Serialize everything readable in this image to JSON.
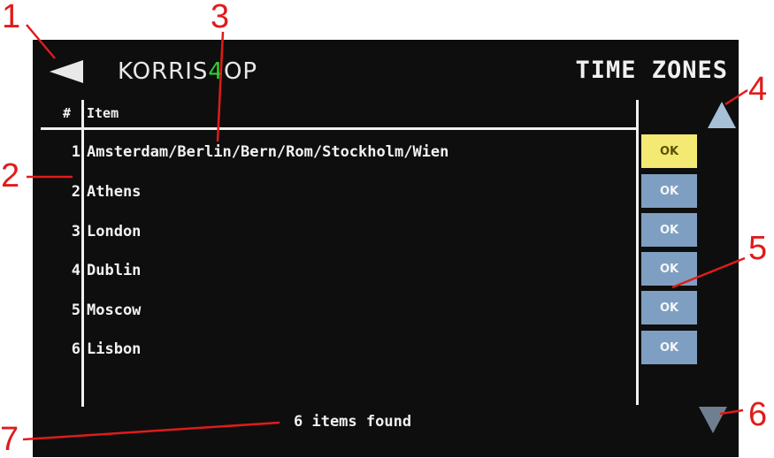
{
  "header": {
    "logo_text_1": "KORRIS",
    "logo_text_accent": "4",
    "logo_text_2": "OP",
    "title": "TIME ZONES"
  },
  "table": {
    "columns": [
      "#",
      "Item"
    ],
    "rows": [
      {
        "num": "1",
        "name": "Amsterdam/Berlin/Bern/Rom/Stockholm/Wien",
        "button": "OK",
        "selected": true
      },
      {
        "num": "2",
        "name": "Athens",
        "button": "OK",
        "selected": false
      },
      {
        "num": "3",
        "name": "London",
        "button": "OK",
        "selected": false
      },
      {
        "num": "4",
        "name": "Dublin",
        "button": "OK",
        "selected": false
      },
      {
        "num": "5",
        "name": "Moscow",
        "button": "OK",
        "selected": false
      },
      {
        "num": "6",
        "name": "Lisbon",
        "button": "OK",
        "selected": false
      }
    ]
  },
  "status_text": "6 items found",
  "callouts": [
    "1",
    "2",
    "3",
    "4",
    "5",
    "6",
    "7"
  ],
  "icons": {
    "back": "back-arrow-icon",
    "scroll_up": "scroll-up-arrow-icon",
    "scroll_down": "scroll-down-arrow-icon"
  },
  "colors": {
    "screen_bg": "#0e0e0e",
    "ok_button": "#7f9fc2",
    "ok_selected": "#f3e973",
    "callout": "#e01b1b",
    "logo_accent": "#32cd32"
  }
}
